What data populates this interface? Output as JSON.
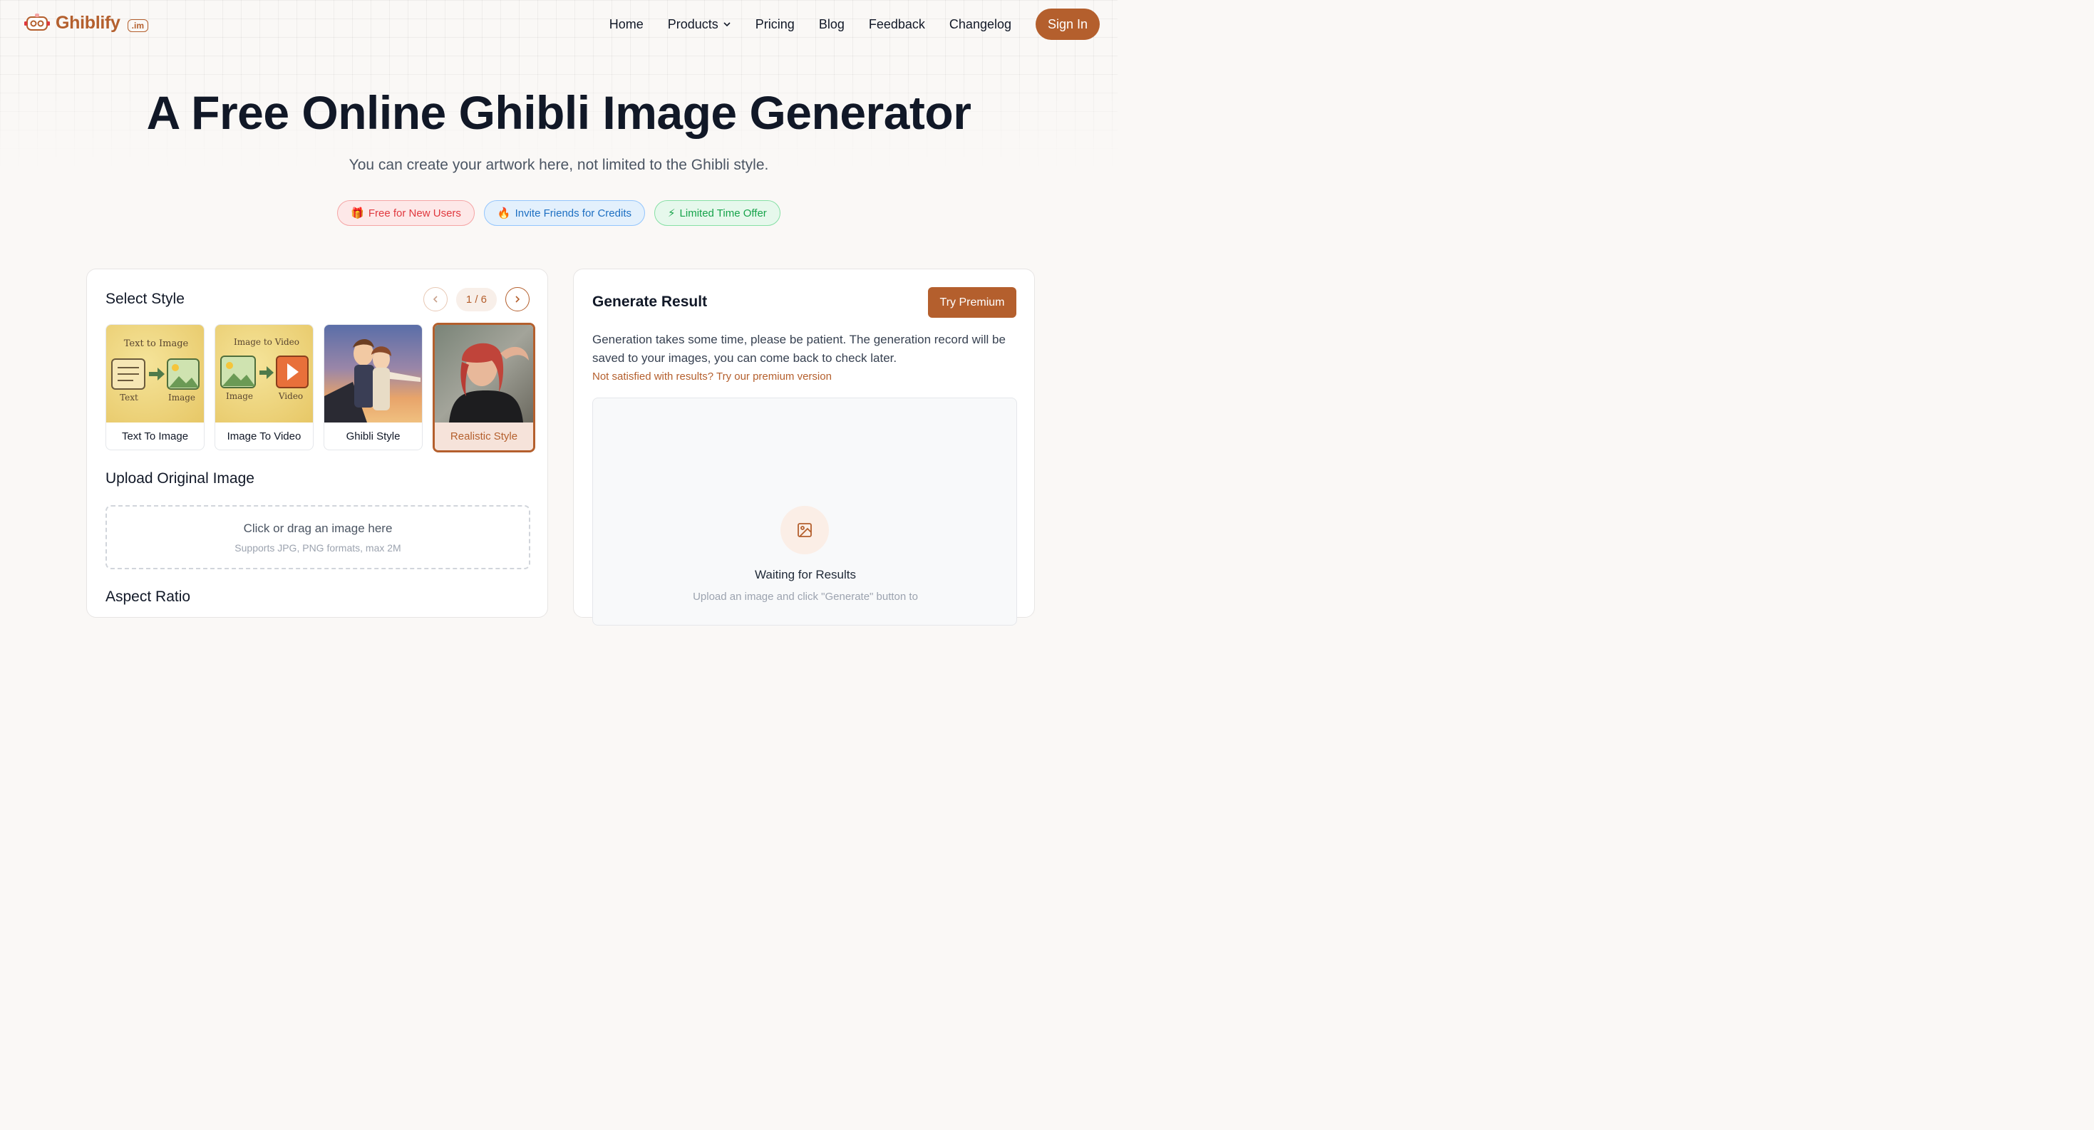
{
  "brand": {
    "name": "Ghiblify",
    "badge": ".im",
    "accent": "#b45f2d"
  },
  "nav": {
    "items": [
      {
        "label": "Home"
      },
      {
        "label": "Products",
        "has_dropdown": true
      },
      {
        "label": "Pricing"
      },
      {
        "label": "Blog"
      },
      {
        "label": "Feedback"
      },
      {
        "label": "Changelog"
      }
    ],
    "signin_label": "Sign In"
  },
  "hero": {
    "title": "A Free Online Ghibli Image Generator",
    "subtitle": "You can create your artwork here, not limited to the Ghibli style.",
    "pills": [
      {
        "icon": "🎁",
        "label": "Free for New Users",
        "variant": "red"
      },
      {
        "icon": "🔥",
        "label": "Invite Friends for Credits",
        "variant": "blue"
      },
      {
        "icon": "⚡",
        "label": "Limited Time Offer",
        "variant": "green"
      }
    ]
  },
  "left_panel": {
    "select_style_title": "Select Style",
    "pager": {
      "text": "1 / 6"
    },
    "styles": [
      {
        "label": "Text To Image",
        "thumb_text": "Text to Image",
        "sub_left": "Text",
        "sub_right": "Image",
        "selected": false
      },
      {
        "label": "Image To Video",
        "thumb_text": "Image to Video",
        "sub_left": "Image",
        "sub_right": "Video",
        "selected": false
      },
      {
        "label": "Ghibli Style",
        "selected": false
      },
      {
        "label": "Realistic Style",
        "selected": true
      }
    ],
    "upload_title": "Upload Original Image",
    "upload_main": "Click or drag an image here",
    "upload_sub": "Supports JPG, PNG formats, max 2M",
    "aspect_title": "Aspect Ratio"
  },
  "right_panel": {
    "title": "Generate Result",
    "premium_label": "Try Premium",
    "description": "Generation takes some time, please be patient. The generation record will be saved to your images, you can come back to check later.",
    "link": "Not satisfied with results? Try our premium version",
    "waiting_title": "Waiting for Results",
    "waiting_sub": "Upload an image and click \"Generate\" button to"
  }
}
